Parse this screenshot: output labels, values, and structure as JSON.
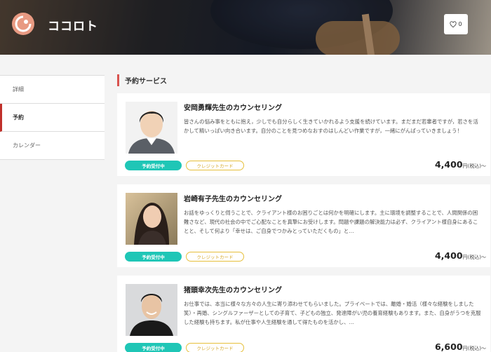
{
  "header": {
    "brand": "ココロト",
    "favorite_count": "0"
  },
  "sidebar": {
    "items": [
      {
        "label": "詳細"
      },
      {
        "label": "予約"
      },
      {
        "label": "カレンダー"
      }
    ]
  },
  "section": {
    "title": "予約サービス"
  },
  "cards": [
    {
      "title": "安岡勇輝先生のカウンセリング",
      "description": "皆さんの悩み事をともに抱え，少しでも自分らしく生きていかれるよう支援を続けています。まだまだ若輩者ですが，若さを活かして精いっぱい向き合います。自分のことを見つめなおすのはしんどい作業ですが，一緒にがんばっていきましょう！",
      "status_badge": "予約受付中",
      "payment_badge": "クレジットカード",
      "price": "4,400",
      "price_unit": "円(税込)〜"
    },
    {
      "title": "岩崎有子先生のカウンセリング",
      "description": "お話をゆっくりと伺うことで、クライアント様のお困りごとは何かを明確にします。主に環境を調整することで、人間関係の困難さなど、現代の社会の中でご心配なことを真摯にお受けします。問題や課題の解決能力は必ず、クライアント様自身にあることと、そして何より「幸せは、ご自身でつかみとっていただくもの」と…",
      "status_badge": "予約受付中",
      "payment_badge": "クレジットカード",
      "price": "4,400",
      "price_unit": "円(税込)〜"
    },
    {
      "title": "猪頭幸次先生のカウンセリング",
      "description": "お仕事では、本当に様々な方々の人生に寄り添わせてもらいました。プライベートでは、離婚・婚活（様々な経験をしました笑）・再婚、シングルファーザーとしての子育て、子どもの独立、発達障がい児の養育経験もあります。また、自身がうつを克服した経験も持ちます。私が仕事や人生経験を通して得たものを活かし、…",
      "status_badge": "予約受付中",
      "payment_badge": "クレジットカード",
      "price": "6,600",
      "price_unit": "円(税込)〜"
    }
  ],
  "colors": {
    "accent_red": "#d9534f",
    "badge_teal": "#1fc6b6",
    "badge_gold": "#e6bf3a"
  }
}
